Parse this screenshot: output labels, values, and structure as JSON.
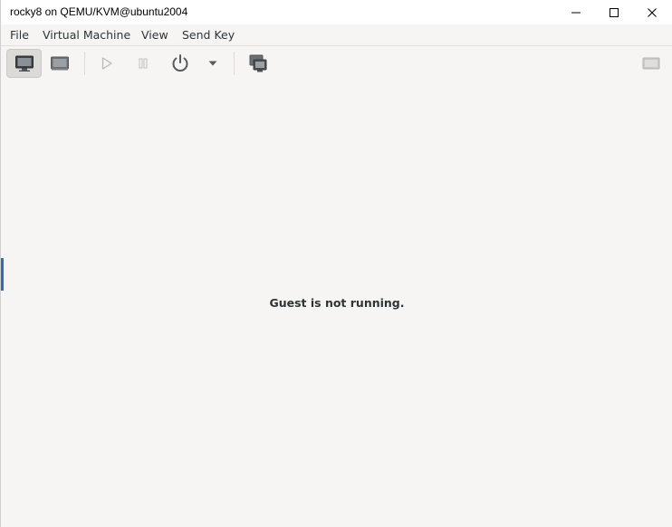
{
  "window": {
    "title": "rocky8 on QEMU/KVM@ubuntu2004",
    "controls": {
      "minimize_icon": "minimize-icon",
      "maximize_icon": "maximize-icon",
      "close_icon": "close-icon"
    }
  },
  "menu": {
    "items": [
      {
        "label": "File"
      },
      {
        "label": "Virtual Machine"
      },
      {
        "label": "View"
      },
      {
        "label": "Send Key"
      }
    ]
  },
  "toolbar": {
    "buttons": [
      {
        "icon": "console-monitor-icon",
        "active": true
      },
      {
        "icon": "details-icon",
        "active": false
      },
      {
        "icon": "run-icon",
        "active": false
      },
      {
        "icon": "pause-icon",
        "active": false
      },
      {
        "icon": "power-icon",
        "active": false
      },
      {
        "icon": "power-dropdown-icon",
        "active": false
      },
      {
        "icon": "snapshots-icon",
        "active": false
      },
      {
        "icon": "fullscreen-icon",
        "active": false
      }
    ]
  },
  "content": {
    "message": "Guest is not running."
  },
  "colors": {
    "background": "#f6f5f4",
    "titlebar": "#ffffff",
    "text": "#2e3436",
    "accent": "#2f6cb5"
  }
}
